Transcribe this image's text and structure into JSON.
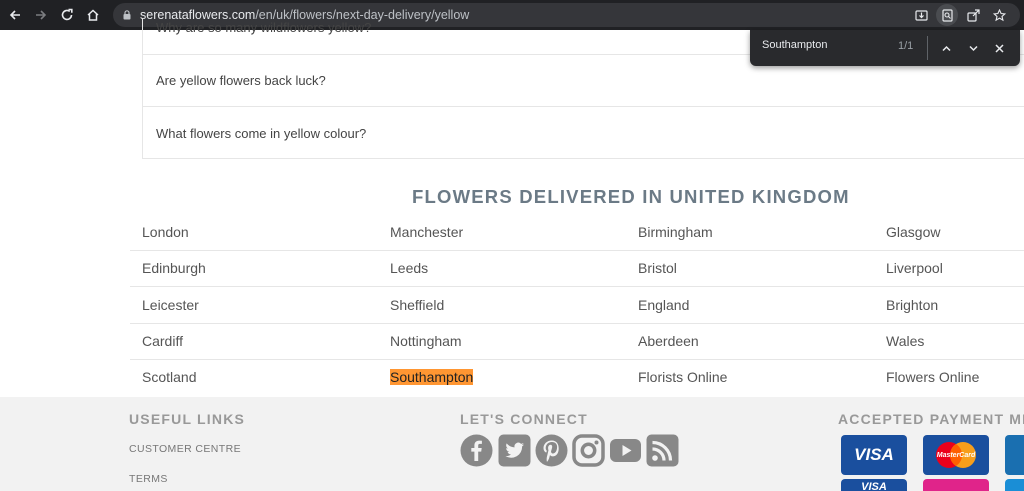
{
  "browser": {
    "url_host": "serenataflowers.com",
    "url_path": "/en/uk/flowers/next-day-delivery/yellow",
    "icons": [
      "back-icon",
      "forward-icon",
      "reload-icon",
      "home-icon",
      "lock-icon",
      "install-icon",
      "find-icon",
      "share-icon",
      "star-icon"
    ]
  },
  "find": {
    "query": "Southampton",
    "count": "1/1"
  },
  "faq": {
    "items": [
      "Why are so many wildflowers yellow?",
      "Are yellow flowers back luck?",
      "What flowers come in yellow colour?"
    ]
  },
  "cities": {
    "title": "FLOWERS DELIVERED IN UNITED KINGDOM",
    "rows": [
      [
        "London",
        "Manchester",
        "Birmingham",
        "Glasgow"
      ],
      [
        "Edinburgh",
        "Leeds",
        "Bristol",
        "Liverpool"
      ],
      [
        "Leicester",
        "Sheffield",
        "England",
        "Brighton"
      ],
      [
        "Cardiff",
        "Nottingham",
        "Aberdeen",
        "Wales"
      ],
      [
        "Scotland",
        "Southampton",
        "Florists Online",
        "Flowers Online"
      ]
    ],
    "highlight_color": "#ff9632"
  },
  "footer": {
    "useful_links_title": "USEFUL LINKS",
    "links": [
      "CUSTOMER CENTRE",
      "TERMS"
    ],
    "connect_title": "LET'S CONNECT",
    "social_icons": [
      "facebook-icon",
      "twitter-icon",
      "pinterest-icon",
      "instagram-icon",
      "youtube-icon",
      "rss-icon"
    ],
    "payment_title": "ACCEPTED PAYMENT ME",
    "payment": {
      "visa_label": "VISA",
      "mastercard_label": "MasterCard"
    }
  },
  "colors": {
    "toolbar": "#202124",
    "social_icon": "#888888",
    "card_blue": "#1a4f9e"
  }
}
